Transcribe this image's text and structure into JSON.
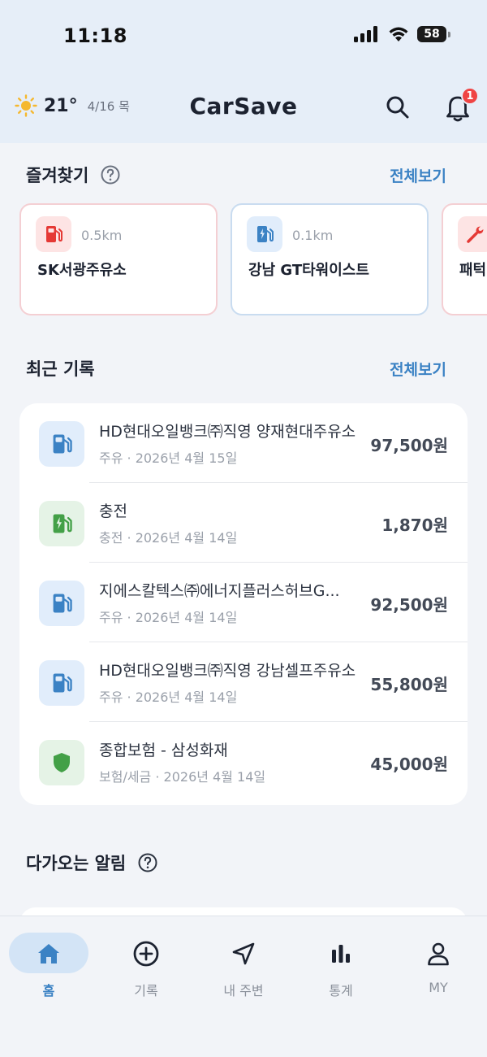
{
  "status_bar": {
    "time": "11:18",
    "battery": "58"
  },
  "header": {
    "temperature": "21°",
    "date": "4/16 목",
    "title": "CarSave",
    "notification_count": "1"
  },
  "favorites": {
    "title": "즐겨찾기",
    "see_all": "전체보기",
    "items": [
      {
        "icon": "fuel-pump-icon",
        "distance": "0.5km",
        "name": "SK서광주유소"
      },
      {
        "icon": "ev-charger-icon",
        "distance": "0.1km",
        "name": "강남 GT타워이스트"
      },
      {
        "icon": "wrench-icon",
        "name": "패턱"
      }
    ]
  },
  "records": {
    "title": "최근 기록",
    "see_all": "전체보기",
    "items": [
      {
        "icon": "fuel-pump-icon",
        "title": "HD현대오일뱅크㈜직영 양재현대주유소",
        "sub": "주유 · 2026년 4월 15일",
        "amount": "97,500원"
      },
      {
        "icon": "ev-charger-icon",
        "title": "충전",
        "sub": "충전 · 2026년 4월 14일",
        "amount": "1,870원"
      },
      {
        "icon": "fuel-pump-icon",
        "title": "지에스칼텍스㈜에너지플러스허브G...",
        "sub": "주유 · 2026년 4월 14일",
        "amount": "92,500원"
      },
      {
        "icon": "fuel-pump-icon",
        "title": "HD현대오일뱅크㈜직영 강남셀프주유소",
        "sub": "주유 · 2026년 4월 14일",
        "amount": "55,800원"
      },
      {
        "icon": "shield-icon",
        "title": "종합보험 - 삼성화재",
        "sub": "보험/세금 · 2026년 4월 14일",
        "amount": "45,000원"
      }
    ]
  },
  "alerts": {
    "title": "다가오는 알림"
  },
  "tabs": [
    {
      "label": "홈",
      "icon": "home-icon",
      "active": true
    },
    {
      "label": "기록",
      "icon": "plus-circle-icon"
    },
    {
      "label": "내 주변",
      "icon": "navigation-icon"
    },
    {
      "label": "통계",
      "icon": "bar-chart-icon"
    },
    {
      "label": "MY",
      "icon": "user-icon"
    }
  ],
  "colors": {
    "accent": "#3b82c4",
    "fuel_red": "#e53935",
    "ev_blue": "#3b82c4",
    "insurance_green": "#43a047",
    "badge_red": "#ef4444"
  }
}
